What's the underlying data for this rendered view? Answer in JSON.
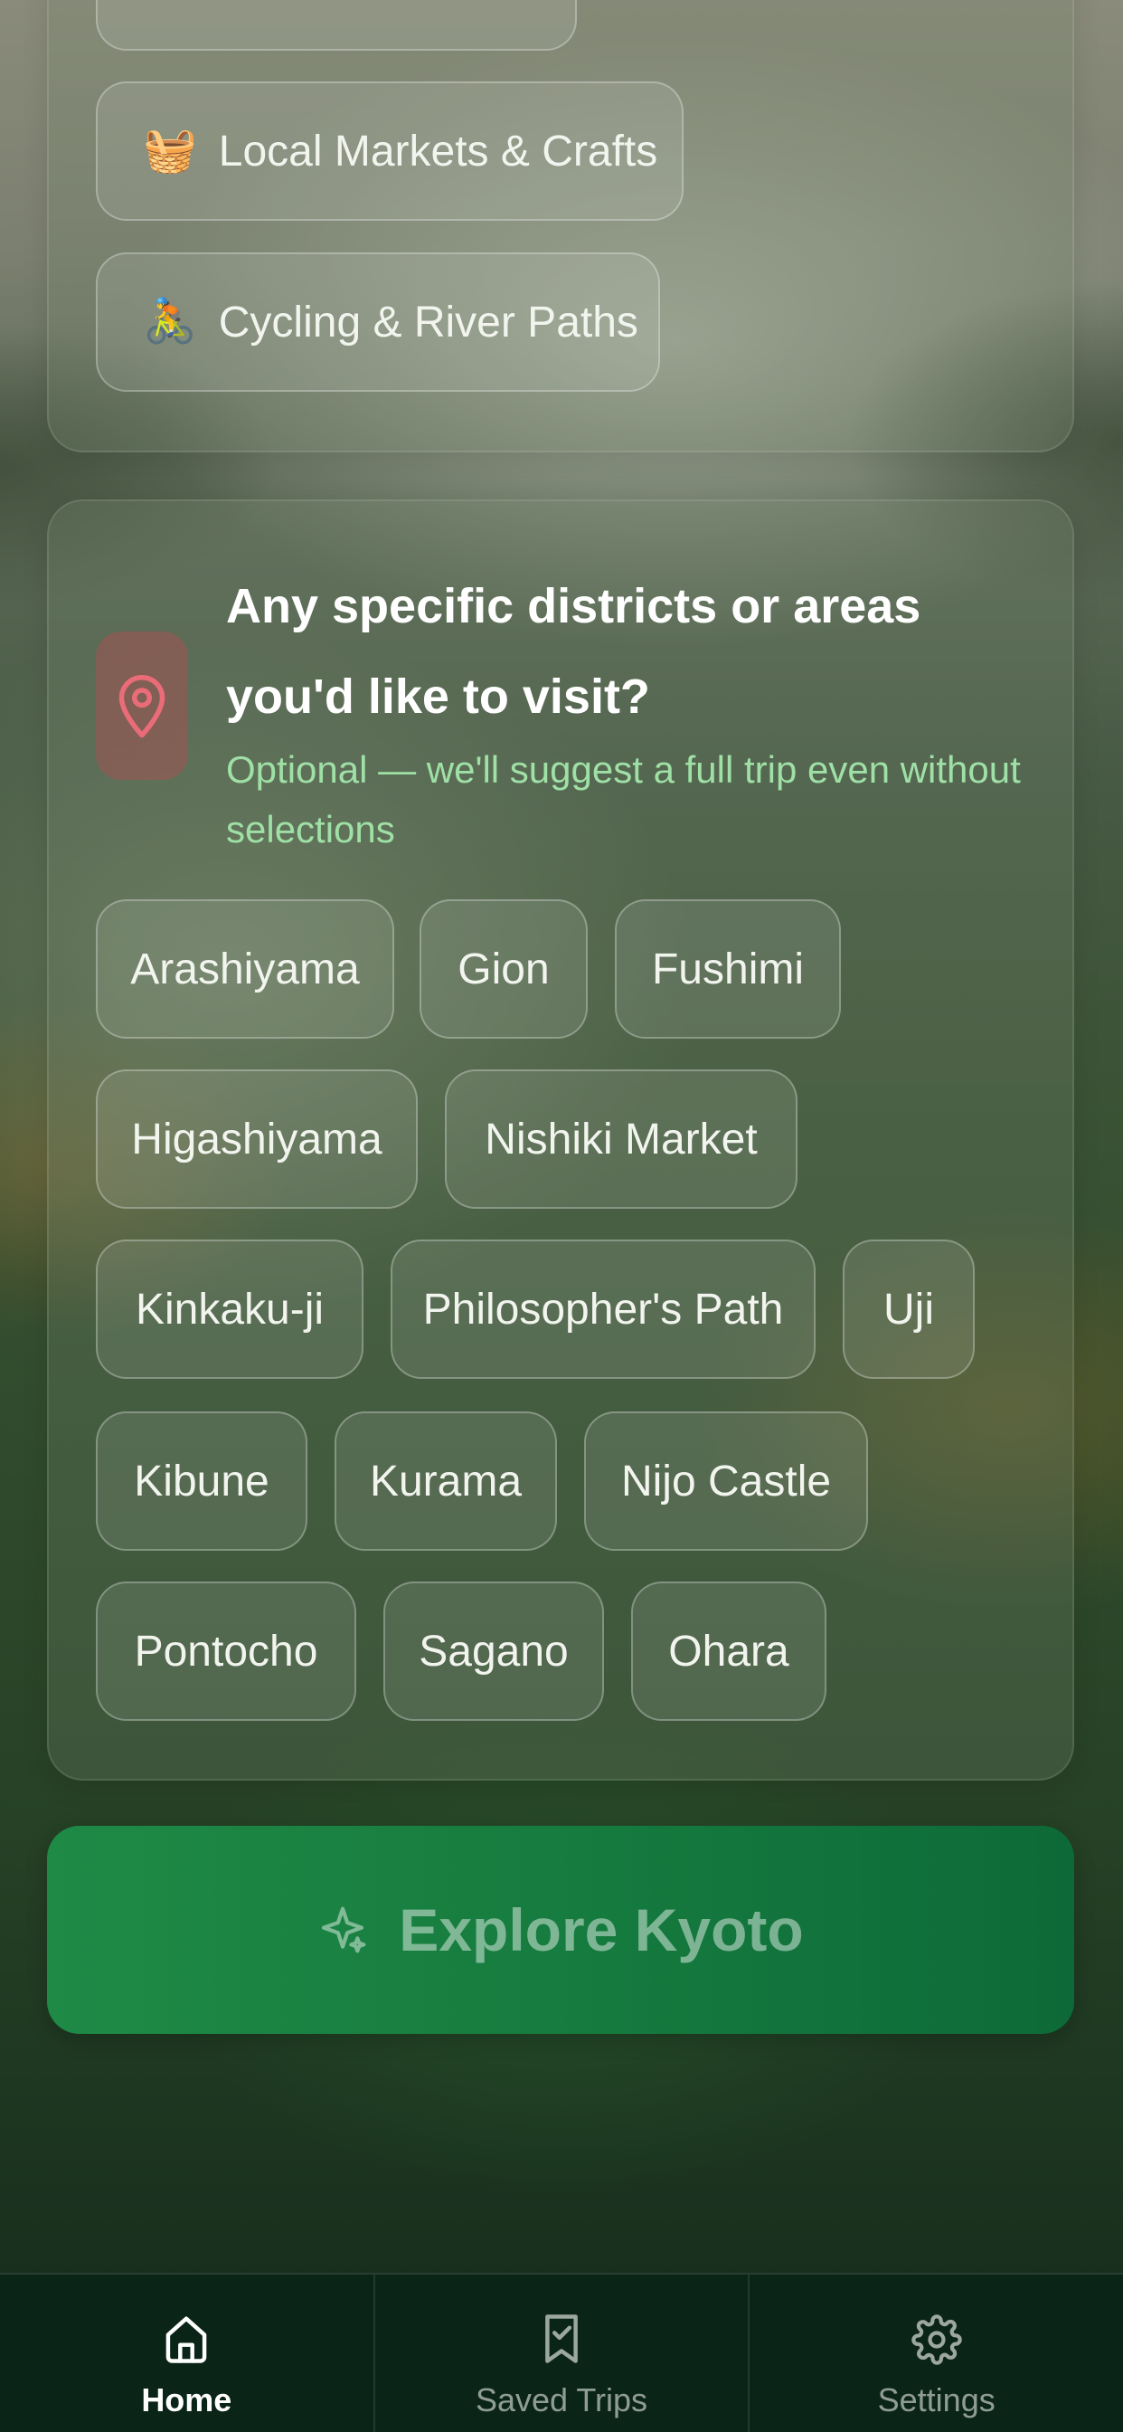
{
  "interests": [
    {
      "emoji": "🧺",
      "label": "Local Markets & Crafts"
    },
    {
      "emoji": "🚴",
      "label": "Cycling & River Paths"
    }
  ],
  "districts_card": {
    "icon": "map-pin-icon",
    "question": "Any specific districts or areas you'd like to visit?",
    "hint": "Optional — we'll suggest a full trip even without selections",
    "options": [
      "Arashiyama",
      "Gion",
      "Fushimi",
      "Higashiyama",
      "Nishiki Market",
      "Kinkaku-ji",
      "Philosopher's Path",
      "Uji",
      "Kibune",
      "Kurama",
      "Nijo Castle",
      "Pontocho",
      "Sagano",
      "Ohara"
    ]
  },
  "cta": {
    "label": "Explore Kyoto",
    "icon": "sparkle-icon"
  },
  "tabbar": {
    "active": "home",
    "items": [
      {
        "id": "home",
        "label": "Home",
        "icon": "home-icon"
      },
      {
        "id": "saved",
        "label": "Saved Trips",
        "icon": "bookmark-check-icon"
      },
      {
        "id": "settings",
        "label": "Settings",
        "icon": "gear-icon"
      }
    ]
  },
  "colors": {
    "accent_green": "#1f8a46",
    "hint_green": "#9fe0a6",
    "pin_red": "#e06470",
    "tabbar_bg": "#0a2417"
  }
}
